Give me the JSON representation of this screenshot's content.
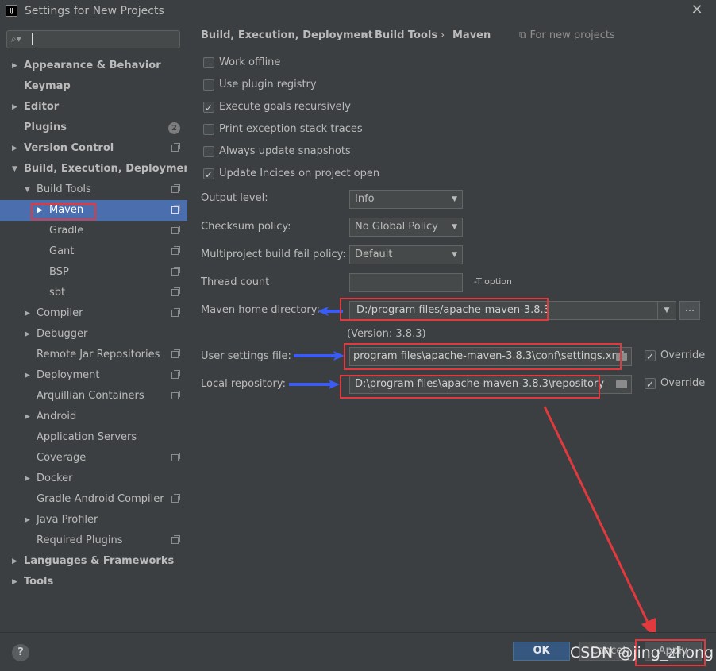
{
  "window": {
    "title": "Settings for New Projects",
    "close_glyph": "✕",
    "app_icon_text": "IJ"
  },
  "sidebar": {
    "search_placeholder": "",
    "items": [
      {
        "label": "Appearance & Behavior"
      },
      {
        "label": "Keymap"
      },
      {
        "label": "Editor"
      },
      {
        "label": "Plugins",
        "badge": "2"
      },
      {
        "label": "Version Control"
      },
      {
        "label": "Build, Execution, Deployment"
      },
      {
        "label": "Build Tools"
      },
      {
        "label": "Maven"
      },
      {
        "label": "Gradle"
      },
      {
        "label": "Gant"
      },
      {
        "label": "BSP"
      },
      {
        "label": "sbt"
      },
      {
        "label": "Compiler"
      },
      {
        "label": "Debugger"
      },
      {
        "label": "Remote Jar Repositories"
      },
      {
        "label": "Deployment"
      },
      {
        "label": "Arquillian Containers"
      },
      {
        "label": "Android"
      },
      {
        "label": "Application Servers"
      },
      {
        "label": "Coverage"
      },
      {
        "label": "Docker"
      },
      {
        "label": "Gradle-Android Compiler"
      },
      {
        "label": "Java Profiler"
      },
      {
        "label": "Required Plugins"
      },
      {
        "label": "Languages & Frameworks"
      },
      {
        "label": "Tools"
      }
    ]
  },
  "breadcrumb": {
    "items": [
      "Build, Execution, Deployment",
      "Build Tools",
      "Maven"
    ],
    "separator": "›",
    "scope": "For new projects"
  },
  "options": {
    "checkboxes": [
      {
        "label": "Work offline",
        "checked": false
      },
      {
        "label": "Use plugin registry",
        "checked": false
      },
      {
        "label": "Execute goals recursively",
        "checked": true
      },
      {
        "label": "Print exception stack traces",
        "checked": false
      },
      {
        "label": "Always update snapshots",
        "checked": false
      },
      {
        "label": "Update Incices on project open",
        "checked": true
      }
    ],
    "output_level": {
      "label": "Output level:",
      "value": "Info"
    },
    "checksum_policy": {
      "label": "Checksum policy:",
      "value": "No Global Policy"
    },
    "fail_policy": {
      "label": "Multiproject build fail policy:",
      "value": "Default"
    },
    "thread_count": {
      "label": "Thread count",
      "value": "",
      "hint": "-T option"
    },
    "maven_home": {
      "label": "Maven home directory:",
      "value": "D:/program files/apache-maven-3.8.3",
      "browse": "...",
      "version": "(Version: 3.8.3)"
    },
    "user_settings": {
      "label": "User settings file:",
      "value": "program files\\apache-maven-3.8.3\\conf\\settings.xml",
      "override_label": "Override",
      "override_checked": true
    },
    "local_repo": {
      "label": "Local repository:",
      "value": "D:\\program files\\apache-maven-3.8.3\\repository",
      "override_label": "Override",
      "override_checked": true
    }
  },
  "footer": {
    "help": "?",
    "ok": "OK",
    "cancel": "Cancel",
    "apply": "Apply",
    "watermark": "CSDN @jing_zhong"
  },
  "colors": {
    "annotation_red": "#e0393e",
    "annotation_blue": "#3a5cf2",
    "selection": "#4b6eaf"
  }
}
